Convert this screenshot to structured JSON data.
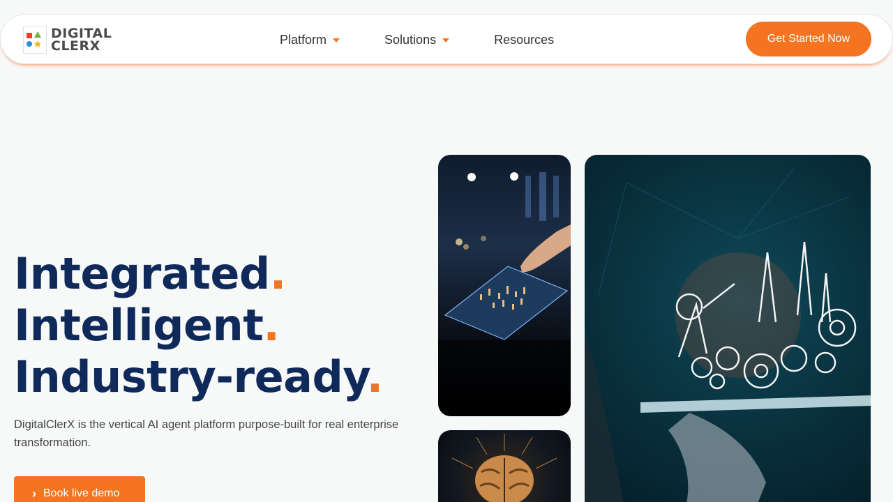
{
  "brand": {
    "logo_line1": "DIGITAL",
    "logo_line2": "CLERX"
  },
  "nav": {
    "items": [
      {
        "label": "Platform",
        "has_dropdown": true
      },
      {
        "label": "Solutions",
        "has_dropdown": true
      },
      {
        "label": "Resources",
        "has_dropdown": false
      }
    ],
    "cta_label": "Get Started Now"
  },
  "hero": {
    "line1": "Integrated",
    "line2": "Intelligent",
    "line3": "Industry-ready",
    "dot": ".",
    "subtext": "DigitalClerX is the vertical AI agent platform purpose-built for real enterprise transformation.",
    "demo_button_label": "Book live demo"
  },
  "colors": {
    "accent": "#f47421",
    "heading": "#0f2a5a",
    "background": "#f7f8f8"
  },
  "icons": {
    "demo_button_icon": "chevron-right-icon",
    "dropdown_icon": "caret-down-icon"
  }
}
